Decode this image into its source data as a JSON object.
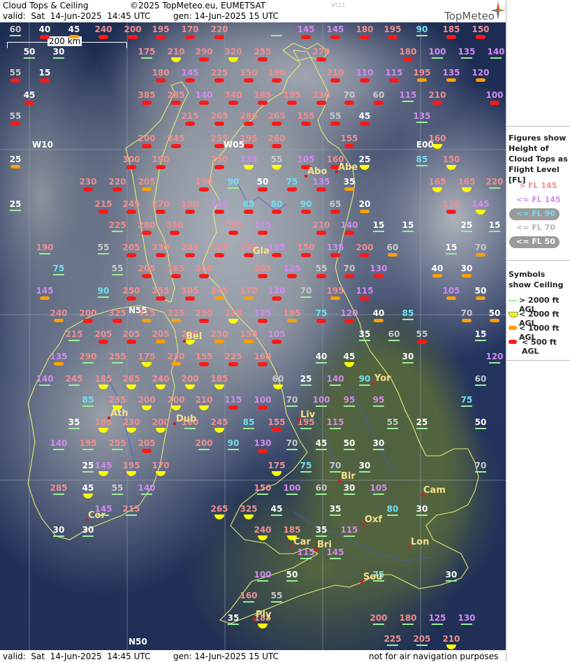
{
  "header": {
    "title": "Cloud Tops & Ceiling",
    "copyright": "©2025 TopMeteo.eu, EUMETSAT",
    "valid": "valid:  Sat  14-Jun-2025  14:45 UTC",
    "gen": "gen: 14-Jun-2025 15 UTC",
    "code": "9521",
    "brand": "TopMeteo"
  },
  "footer": {
    "valid": "valid:  Sat  14-Jun-2025  14:45 UTC",
    "gen": "gen: 14-Jun-2025 15 UTC",
    "disclaimer": "not for air navigation purposes"
  },
  "scale_label": "200 km",
  "grid_labels": [
    "W10",
    "W05",
    "E00",
    "N55",
    "N50"
  ],
  "legend": {
    "figures_title": "Figures show Height of Cloud Tops as Flight Level  [FL]",
    "figures": [
      {
        "label": "> FL 145",
        "color": "#f08f8f"
      },
      {
        "label": "<= FL 145",
        "color": "#d28bf0"
      },
      {
        "label": "<= FL 90",
        "color": "#6fe0f0"
      },
      {
        "label": "<= FL 70",
        "color": "#c8c8c8"
      },
      {
        "label": "<= FL 50",
        "color": "#ffffff"
      }
    ],
    "symbols_title": "Symbols show Ceiling",
    "symbols": [
      {
        "label": "> 2000 ft AGL",
        "icon": "green-line-icon"
      },
      {
        "label": "< 2000 ft AGL",
        "icon": "yellow-half-circle-icon"
      },
      {
        "label": "< 1000 ft AGL",
        "icon": "orange-bar-icon"
      },
      {
        "label": "< 500 ft AGL",
        "icon": "red-bar-icon"
      }
    ]
  },
  "cities": [
    "Abo",
    "Abe",
    "Gla",
    "Bel",
    "Yor",
    "Ath",
    "Dub",
    "Liv",
    "Bir",
    "Cam",
    "Cor",
    "Oxf",
    "Car",
    "Bri",
    "Lon",
    "Sou",
    "Ply"
  ],
  "stations": [
    [
      "60",
      "line"
    ],
    [
      "40",
      "red"
    ],
    [
      "45",
      "org"
    ],
    [
      "240",
      "red"
    ],
    [
      "200",
      "red"
    ],
    [
      "195",
      "red"
    ],
    [
      "170",
      "red"
    ],
    [
      "220",
      "red"
    ],
    [
      "",
      "line"
    ],
    [
      "145",
      "red"
    ],
    [
      "145",
      "red"
    ],
    [
      "180",
      "red"
    ],
    [
      "195",
      "red"
    ],
    [
      "90",
      "line"
    ],
    [
      "185",
      "red"
    ],
    [
      "150",
      "red"
    ],
    [
      "50",
      "line"
    ],
    [
      "30",
      "line"
    ],
    [
      "175",
      "line"
    ],
    [
      "210",
      "yel"
    ],
    [
      "290",
      "red"
    ],
    [
      "320",
      "yel"
    ],
    [
      "255",
      "red"
    ],
    [
      "270",
      "red"
    ],
    [
      "180",
      "red"
    ],
    [
      "100",
      "line"
    ],
    [
      "135",
      "line"
    ],
    [
      "140",
      "line"
    ],
    [
      "55",
      "red"
    ],
    [
      "15",
      "red"
    ],
    [
      "180",
      "red"
    ],
    [
      "145",
      "red"
    ],
    [
      "225",
      "red"
    ],
    [
      "150",
      "red"
    ],
    [
      "190",
      "red"
    ],
    [
      "210",
      "red"
    ],
    [
      "110",
      "red"
    ],
    [
      "115",
      "red"
    ],
    [
      "195",
      "org"
    ],
    [
      "135",
      "org"
    ],
    [
      "120",
      "org"
    ],
    [
      "45",
      "red"
    ],
    [
      "385",
      "red"
    ],
    [
      "285",
      "red"
    ],
    [
      "140",
      "red"
    ],
    [
      "340",
      "red"
    ],
    [
      "185",
      "red"
    ],
    [
      "195",
      "red"
    ],
    [
      "230",
      "red"
    ],
    [
      "70",
      "red"
    ],
    [
      "60",
      "red"
    ],
    [
      "115",
      "line"
    ],
    [
      "210",
      "red"
    ],
    [
      "100",
      "red"
    ],
    [
      "55",
      "red"
    ],
    [
      "215",
      "red"
    ],
    [
      "265",
      "red"
    ],
    [
      "280",
      "red"
    ],
    [
      "265",
      "red"
    ],
    [
      "155",
      "red"
    ],
    [
      "55",
      "red"
    ],
    [
      "45",
      "red"
    ],
    [
      "135",
      "line"
    ],
    [
      "200",
      "red"
    ],
    [
      "245",
      "red"
    ],
    [
      "255",
      "red"
    ],
    [
      "195",
      "red"
    ],
    [
      "260",
      "red"
    ],
    [
      "155",
      "red"
    ],
    [
      "160",
      "yel"
    ],
    [
      "25",
      "org"
    ],
    [
      "300",
      "red"
    ],
    [
      "190",
      "red"
    ],
    [
      "250",
      "red"
    ],
    [
      "135",
      "yel"
    ],
    [
      "55",
      "yel"
    ],
    [
      "105",
      "red"
    ],
    [
      "160",
      "red"
    ],
    [
      "25",
      "yel"
    ],
    [
      "85",
      "line"
    ],
    [
      "150",
      "yel"
    ],
    [
      "230",
      "red"
    ],
    [
      "220",
      "red"
    ],
    [
      "205",
      "org"
    ],
    [
      "190",
      "red"
    ],
    [
      "90",
      "line"
    ],
    [
      "50",
      "red"
    ],
    [
      "75",
      "red"
    ],
    [
      "135",
      "red"
    ],
    [
      "35",
      "org"
    ],
    [
      "165",
      "yel"
    ],
    [
      "165",
      "yel"
    ],
    [
      "220",
      "line"
    ],
    [
      "25",
      "line"
    ],
    [
      "215",
      "red"
    ],
    [
      "245",
      "red"
    ],
    [
      "270",
      "red"
    ],
    [
      "190",
      "red"
    ],
    [
      "140",
      "red"
    ],
    [
      "85",
      "red"
    ],
    [
      "80",
      "red"
    ],
    [
      "90",
      "red"
    ],
    [
      "65",
      "red"
    ],
    [
      "20",
      "org"
    ],
    [
      "170",
      "red"
    ],
    [
      "145",
      "yel"
    ],
    [
      "225",
      "line"
    ],
    [
      "280",
      "red"
    ],
    [
      "350",
      "red"
    ],
    [
      "190",
      "red"
    ],
    [
      "115",
      "red"
    ],
    [
      "210",
      "red"
    ],
    [
      "140",
      "red"
    ],
    [
      "15",
      "line"
    ],
    [
      "15",
      "line"
    ],
    [
      "25",
      "line"
    ],
    [
      "15",
      "line"
    ],
    [
      "190",
      "line"
    ],
    [
      "55",
      "line"
    ],
    [
      "205",
      "red"
    ],
    [
      "230",
      "red"
    ],
    [
      "245",
      "red"
    ],
    [
      "185",
      "red"
    ],
    [
      "230",
      "red"
    ],
    [
      "105",
      "red"
    ],
    [
      "150",
      "red"
    ],
    [
      "135",
      "red"
    ],
    [
      "200",
      "red"
    ],
    [
      "60",
      "org"
    ],
    [
      "15",
      "line"
    ],
    [
      "70",
      "org"
    ],
    [
      "75",
      "line"
    ],
    [
      "55",
      "line"
    ],
    [
      "205",
      "red"
    ],
    [
      "165",
      "red"
    ],
    [
      "260",
      "red"
    ],
    [
      "205",
      "red"
    ],
    [
      "125",
      "red"
    ],
    [
      "55",
      "red"
    ],
    [
      "70",
      "red"
    ],
    [
      "130",
      "red"
    ],
    [
      "40",
      "org"
    ],
    [
      "30",
      "org"
    ],
    [
      "145",
      "org"
    ],
    [
      "90",
      "line"
    ],
    [
      "250",
      "red"
    ],
    [
      "255",
      "red"
    ],
    [
      "305",
      "red"
    ],
    [
      "245",
      "org"
    ],
    [
      "170",
      "org"
    ],
    [
      "120",
      "red"
    ],
    [
      "70",
      "line"
    ],
    [
      "195",
      "org"
    ],
    [
      "115",
      "red"
    ],
    [
      "105",
      "org"
    ],
    [
      "50",
      "org"
    ],
    [
      "240",
      "org"
    ],
    [
      "200",
      "red"
    ],
    [
      "325",
      "red"
    ],
    [
      "315",
      "org"
    ],
    [
      "225",
      "org"
    ],
    [
      "250",
      "red"
    ],
    [
      "230",
      "yel"
    ],
    [
      "125",
      "red"
    ],
    [
      "195",
      "org"
    ],
    [
      "75",
      "red"
    ],
    [
      "120",
      "red"
    ],
    [
      "40",
      "org"
    ],
    [
      "85",
      "line"
    ],
    [
      "70",
      "org"
    ],
    [
      "50",
      "org"
    ],
    [
      "215",
      "line"
    ],
    [
      "205",
      "red"
    ],
    [
      "205",
      "red"
    ],
    [
      "205",
      "org"
    ],
    [
      "200",
      "yel"
    ],
    [
      "250",
      "org"
    ],
    [
      "150",
      "org"
    ],
    [
      "105",
      "red"
    ],
    [
      "35",
      "line"
    ],
    [
      "60",
      "line"
    ],
    [
      "55",
      "red"
    ],
    [
      "15",
      "line"
    ],
    [
      "135",
      "org"
    ],
    [
      "290",
      "line"
    ],
    [
      "255",
      "line"
    ],
    [
      "175",
      "yel"
    ],
    [
      "230",
      "org"
    ],
    [
      "155",
      "red"
    ],
    [
      "225",
      "red"
    ],
    [
      "160",
      "red"
    ],
    [
      "40",
      "line"
    ],
    [
      "45",
      "yel"
    ],
    [
      "30",
      "line"
    ],
    [
      "120",
      "line"
    ],
    [
      "140",
      "line"
    ],
    [
      "245",
      "line"
    ],
    [
      "185",
      "yel"
    ],
    [
      "265",
      "yel"
    ],
    [
      "240",
      "yel"
    ],
    [
      "200",
      "yel"
    ],
    [
      "185",
      "yel"
    ],
    [
      "60",
      "yel"
    ],
    [
      "25",
      "line"
    ],
    [
      "140",
      "line"
    ],
    [
      "90",
      "line"
    ],
    [
      "60",
      "line"
    ],
    [
      "85",
      "line"
    ],
    [
      "235",
      "yel"
    ],
    [
      "200",
      "yel"
    ],
    [
      "200",
      "yel"
    ],
    [
      "210",
      "yel"
    ],
    [
      "115",
      "red"
    ],
    [
      "100",
      "red"
    ],
    [
      "70",
      "line"
    ],
    [
      "100",
      "line"
    ],
    [
      "95",
      "line"
    ],
    [
      "95",
      "line"
    ],
    [
      "75",
      "line"
    ],
    [
      "35",
      "line"
    ],
    [
      "185",
      "yel"
    ],
    [
      "230",
      "yel"
    ],
    [
      "200",
      "yel"
    ],
    [
      "160",
      "line"
    ],
    [
      "245",
      "yel"
    ],
    [
      "85",
      "line"
    ],
    [
      "155",
      "red"
    ],
    [
      "195",
      "line"
    ],
    [
      "115",
      "line"
    ],
    [
      "55",
      "line"
    ],
    [
      "25",
      "line"
    ],
    [
      "50",
      "line"
    ],
    [
      "140",
      "line"
    ],
    [
      "195",
      "line"
    ],
    [
      "255",
      "line"
    ],
    [
      "205",
      "red"
    ],
    [
      "200",
      "line"
    ],
    [
      "90",
      "line"
    ],
    [
      "130",
      "red"
    ],
    [
      "70",
      "line"
    ],
    [
      "45",
      "line"
    ],
    [
      "50",
      "line"
    ],
    [
      "30",
      "line"
    ],
    [
      "25",
      "line"
    ],
    [
      "145",
      "yel"
    ],
    [
      "195",
      "yel"
    ],
    [
      "170",
      "yel"
    ],
    [
      "175",
      "yel"
    ],
    [
      "75",
      "line"
    ],
    [
      "70",
      "line"
    ],
    [
      "30",
      "line"
    ],
    [
      "70",
      "line"
    ],
    [
      "285",
      "line"
    ],
    [
      "45",
      "yel"
    ],
    [
      "55",
      "line"
    ],
    [
      "140",
      "line"
    ],
    [
      "150",
      "line"
    ],
    [
      "100",
      "line"
    ],
    [
      "60",
      "line"
    ],
    [
      "30",
      "line"
    ],
    [
      "105",
      "line"
    ],
    [
      "145",
      "line"
    ],
    [
      "215",
      "line"
    ],
    [
      "265",
      "yel"
    ],
    [
      "325",
      "yel"
    ],
    [
      "45",
      "line"
    ],
    [
      "35",
      "line"
    ],
    [
      "80",
      "line"
    ],
    [
      "30",
      "line"
    ],
    [
      "30",
      "line"
    ],
    [
      "30",
      "line"
    ],
    [
      "240",
      "yel"
    ],
    [
      "185",
      "yel"
    ],
    [
      "35",
      "line"
    ],
    [
      "115",
      "line"
    ],
    [
      "115",
      "line"
    ],
    [
      "145",
      "line"
    ],
    [
      "100",
      "line"
    ],
    [
      "50",
      "line"
    ],
    [
      "75",
      "line"
    ],
    [
      "30",
      "line"
    ],
    [
      "160",
      "line"
    ],
    [
      "55",
      "line"
    ],
    [
      "35",
      "line"
    ],
    [
      "185",
      "yel"
    ],
    [
      "200",
      "line"
    ],
    [
      "180",
      "line"
    ],
    [
      "125",
      "line"
    ],
    [
      "130",
      "line"
    ],
    [
      "225",
      "line"
    ],
    [
      "205",
      "line"
    ],
    [
      "210",
      "yel"
    ]
  ]
}
